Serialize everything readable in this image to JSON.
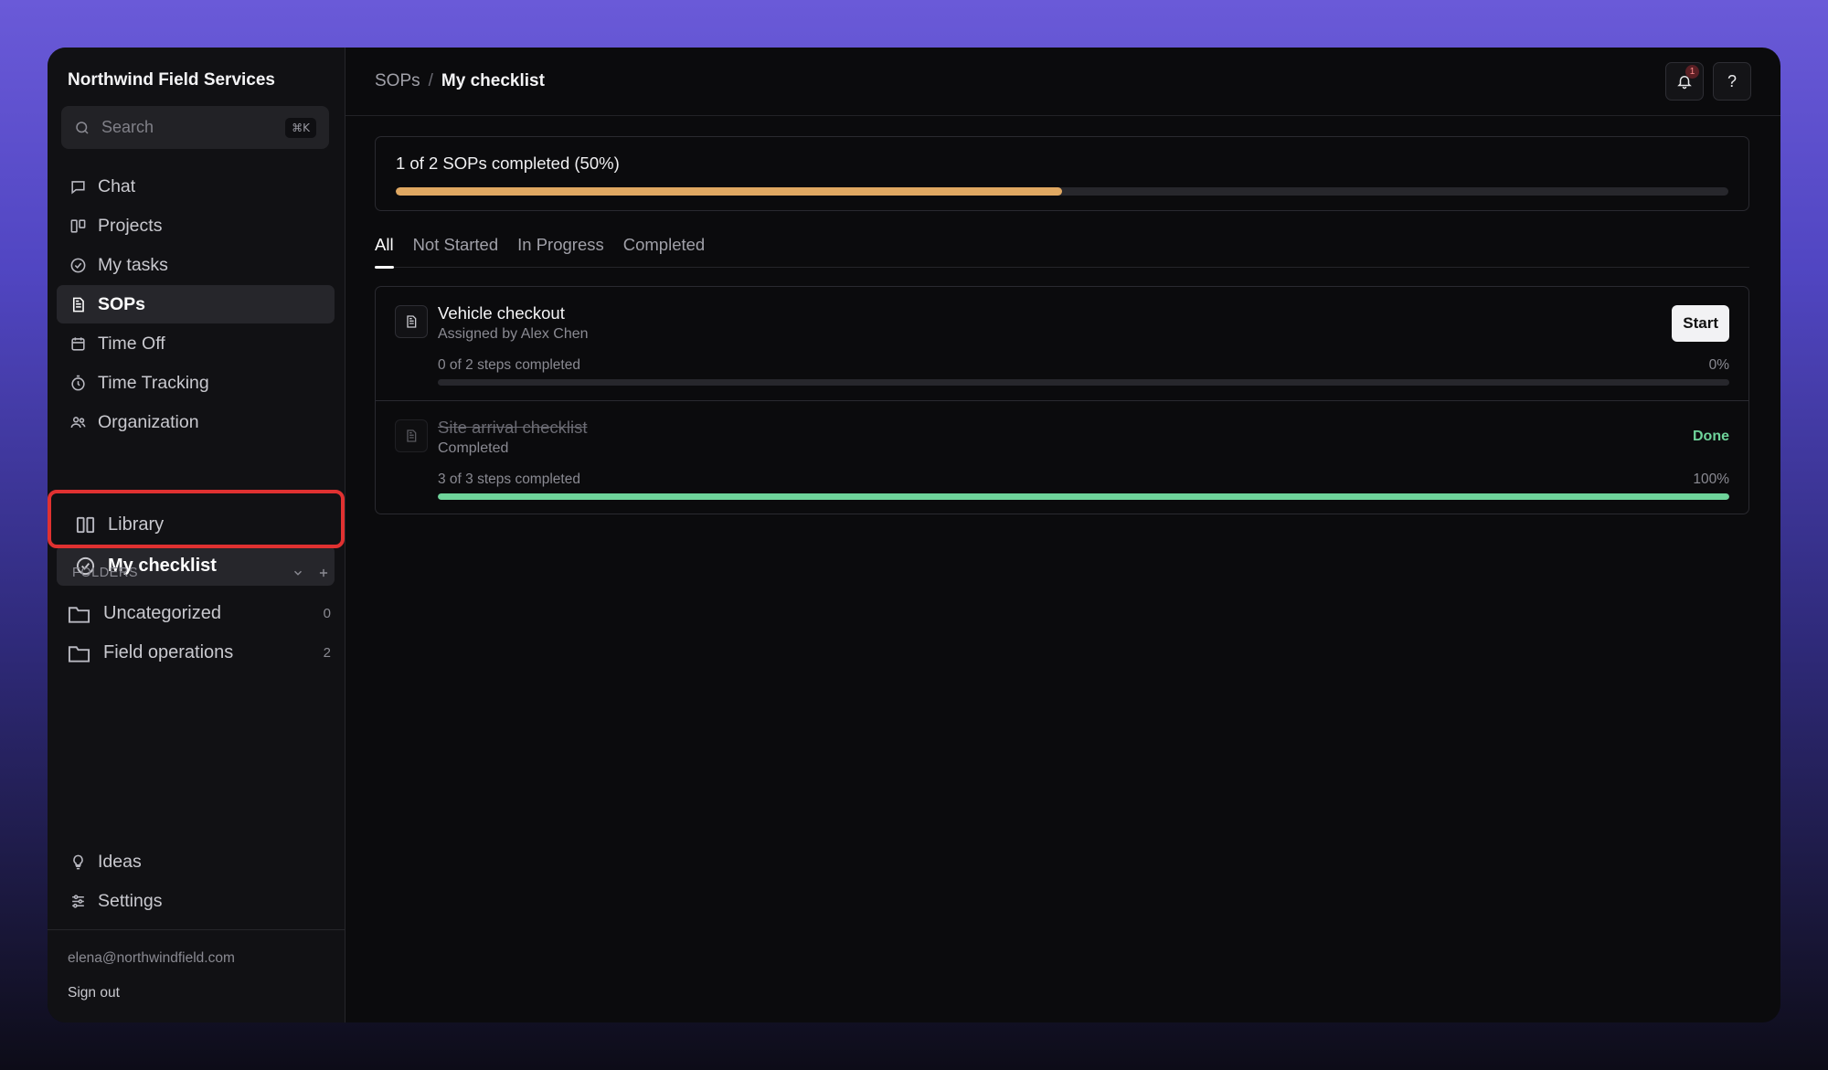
{
  "app": {
    "name": "Northwind Field Services"
  },
  "search": {
    "placeholder": "Search",
    "shortcut": "⌘K"
  },
  "sidebar": {
    "items": [
      {
        "label": "Chat",
        "icon": "chat-icon"
      },
      {
        "label": "Projects",
        "icon": "kanban-icon"
      },
      {
        "label": "My tasks",
        "icon": "check-circle-icon"
      },
      {
        "label": "SOPs",
        "icon": "document-icon",
        "active": true
      },
      {
        "label": "Time Off",
        "icon": "calendar-icon"
      },
      {
        "label": "Time Tracking",
        "icon": "stopwatch-icon"
      },
      {
        "label": "Organization",
        "icon": "people-icon"
      }
    ],
    "library": [
      {
        "label": "Library",
        "icon": "columns-icon"
      },
      {
        "label": "My checklist",
        "icon": "check-circle-icon",
        "active": true
      }
    ],
    "folders_title": "FOLDERS",
    "folders": [
      {
        "label": "Uncategorized",
        "count": "0"
      },
      {
        "label": "Field operations",
        "count": "2"
      }
    ],
    "bottom": [
      {
        "label": "Ideas",
        "icon": "lightbulb-icon"
      },
      {
        "label": "Settings",
        "icon": "sliders-icon"
      }
    ],
    "user_email": "elena@northwindfield.com",
    "sign_out": "Sign out"
  },
  "header": {
    "breadcrumb": [
      "SOPs",
      "/",
      "My checklist"
    ],
    "notifications_count": "1",
    "help_label": "?"
  },
  "progress": {
    "label": "1 of 2 SOPs completed (50%)",
    "fraction": 0.5,
    "color": "#e0a862"
  },
  "tabs": [
    "All",
    "Not Started",
    "In Progress",
    "Completed"
  ],
  "sops": [
    {
      "title": "Vehicle checkout",
      "subtitle": "Assigned by Alex Chen",
      "steps": "0 of 2 steps completed",
      "percent": "0%",
      "fraction": 0,
      "action": "Start"
    },
    {
      "title": "Site arrival checklist",
      "subtitle": "Completed",
      "steps": "3 of 3 steps completed",
      "percent": "100%",
      "fraction": 1,
      "status": "Done",
      "bar_color": "#6ed39a"
    }
  ],
  "colors": {
    "accent": "#e0a862",
    "success": "#6ed39a",
    "highlight": "#e03131"
  }
}
